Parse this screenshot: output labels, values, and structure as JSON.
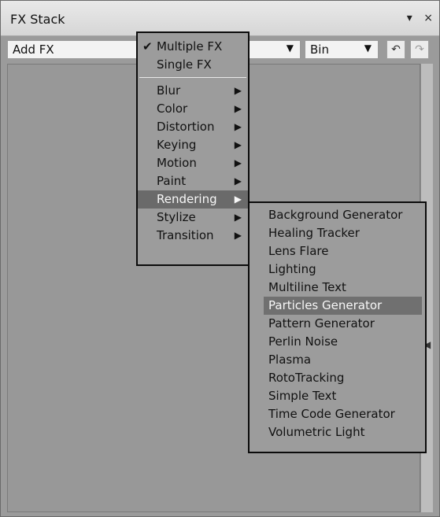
{
  "window": {
    "title": "FX Stack",
    "controls": {
      "dropdown_icon": "▾",
      "close_icon": "×"
    }
  },
  "toolbar": {
    "add_fx_label": "Add FX",
    "bin_label": "Bin",
    "undo_icon": "↶",
    "redo_icon": "↷"
  },
  "main_menu": {
    "modes": [
      {
        "label": "Multiple FX",
        "checked": true
      },
      {
        "label": "Single FX",
        "checked": false
      }
    ],
    "categories": [
      {
        "label": "Blur"
      },
      {
        "label": "Color"
      },
      {
        "label": "Distortion"
      },
      {
        "label": "Keying"
      },
      {
        "label": "Motion"
      },
      {
        "label": "Paint"
      },
      {
        "label": "Rendering",
        "highlight": true
      },
      {
        "label": "Stylize"
      },
      {
        "label": "Transition"
      }
    ]
  },
  "submenu": {
    "items": [
      {
        "label": "Background Generator"
      },
      {
        "label": "Healing Tracker"
      },
      {
        "label": "Lens Flare"
      },
      {
        "label": "Lighting"
      },
      {
        "label": "Multiline Text"
      },
      {
        "label": "Particles Generator",
        "highlight": true
      },
      {
        "label": "Pattern Generator"
      },
      {
        "label": "Perlin Noise"
      },
      {
        "label": "Plasma"
      },
      {
        "label": "RotoTracking"
      },
      {
        "label": "Simple Text"
      },
      {
        "label": "Time Code Generator"
      },
      {
        "label": "Volumetric Light"
      }
    ]
  }
}
